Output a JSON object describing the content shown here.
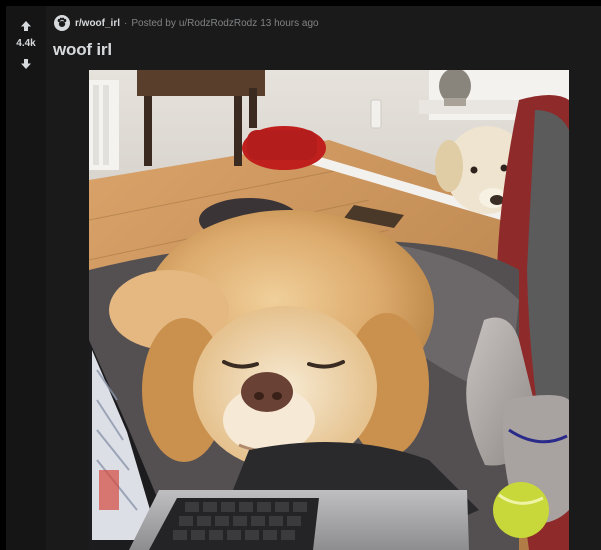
{
  "post": {
    "vote_count": "4.4k",
    "subreddit": "r/woof_irl",
    "posted_by_prefix": "Posted by",
    "author": "u/RodzRodzRodz",
    "time": "13 hours ago",
    "title": "woof irl"
  },
  "icons": {
    "upvote": "arrow-up-icon",
    "downvote": "arrow-down-icon",
    "subreddit": "subreddit-avatar-icon"
  },
  "colors": {
    "background": "#000000",
    "card": "#1a1a1b",
    "text_primary": "#d7dadc",
    "text_muted": "#818384"
  }
}
